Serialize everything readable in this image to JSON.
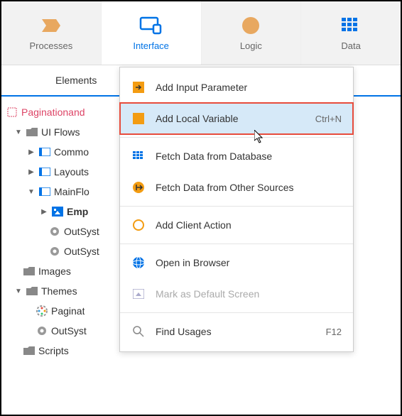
{
  "tabs": {
    "processes": "Processes",
    "interface": "Interface",
    "logic": "Logic",
    "data": "Data"
  },
  "subtabs": {
    "elements": "Elements"
  },
  "tree": {
    "root": "Paginationand",
    "uiflows": "UI Flows",
    "common": "Commo",
    "layouts": "Layouts",
    "mainflow": "MainFlo",
    "emp": "Emp",
    "outsyst1": "OutSyst",
    "outsyst2": "OutSyst",
    "images": "Images",
    "themes": "Themes",
    "paginat": "Paginat",
    "outsyst3": "OutSyst",
    "scripts": "Scripts"
  },
  "menu": {
    "addInput": "Add Input Parameter",
    "addLocal": "Add Local Variable",
    "addLocalShortcut": "Ctrl+N",
    "fetchDb": "Fetch Data from Database",
    "fetchOther": "Fetch Data from Other Sources",
    "clientAction": "Add Client Action",
    "openBrowser": "Open in Browser",
    "markDefault": "Mark as Default Screen",
    "findUsages": "Find Usages",
    "findUsagesShortcut": "F12"
  }
}
